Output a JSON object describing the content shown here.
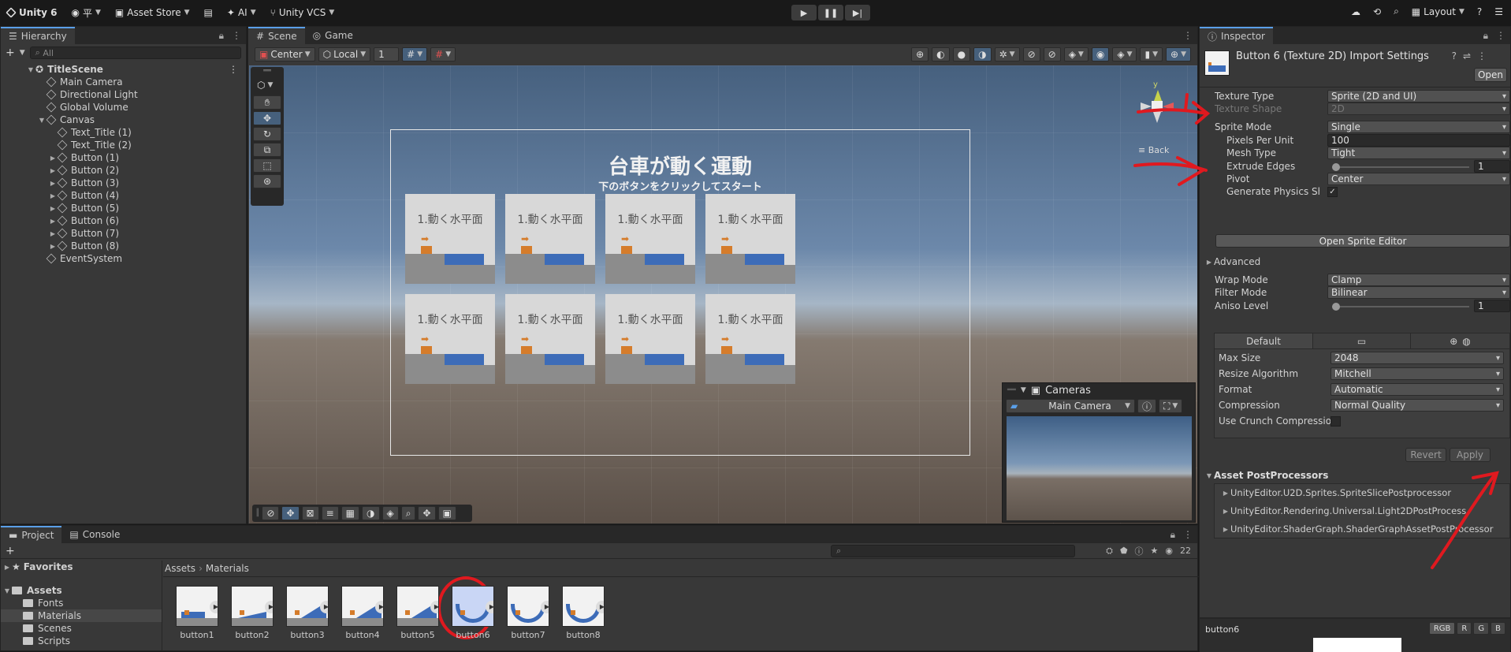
{
  "topbar": {
    "app": "Unity 6",
    "account": "平",
    "asset_store": "Asset Store",
    "ai": "AI",
    "vcs": "Unity VCS",
    "layout": "Layout"
  },
  "hierarchy": {
    "tab": "Hierarchy",
    "search_placeholder": "All",
    "scene": "TitleScene",
    "items": [
      {
        "label": "Main Camera",
        "indent": 1,
        "expandable": false
      },
      {
        "label": "Directional Light",
        "indent": 1,
        "expandable": false
      },
      {
        "label": "Global Volume",
        "indent": 1,
        "expandable": false
      },
      {
        "label": "Canvas",
        "indent": 1,
        "expandable": true,
        "expanded": true
      },
      {
        "label": "Text_Title (1)",
        "indent": 2,
        "expandable": false
      },
      {
        "label": "Text_Title (2)",
        "indent": 2,
        "expandable": false
      },
      {
        "label": "Button (1)",
        "indent": 2,
        "expandable": true
      },
      {
        "label": "Button (2)",
        "indent": 2,
        "expandable": true
      },
      {
        "label": "Button (3)",
        "indent": 2,
        "expandable": true
      },
      {
        "label": "Button (4)",
        "indent": 2,
        "expandable": true
      },
      {
        "label": "Button (5)",
        "indent": 2,
        "expandable": true
      },
      {
        "label": "Button (6)",
        "indent": 2,
        "expandable": true
      },
      {
        "label": "Button (7)",
        "indent": 2,
        "expandable": true
      },
      {
        "label": "Button (8)",
        "indent": 2,
        "expandable": true
      },
      {
        "label": "EventSystem",
        "indent": 1,
        "expandable": false
      }
    ]
  },
  "scene_view": {
    "tabs": [
      "Scene",
      "Game"
    ],
    "pivot": "Center",
    "space": "Local",
    "grid_value": "1",
    "title": "台車が動く運動",
    "subtitle": "下のボタンをクリックしてスタート",
    "card_label": "1.動く水平面",
    "back_label": "Back",
    "gizmo_axis": "y",
    "cameras_title": "Cameras",
    "cameras_selected": "Main Camera"
  },
  "inspector": {
    "tab": "Inspector",
    "title": "Button 6 (Texture 2D) Import Settings",
    "open_button": "Open",
    "fields": {
      "texture_type": {
        "label": "Texture Type",
        "value": "Sprite (2D and UI)"
      },
      "texture_shape": {
        "label": "Texture Shape",
        "value": "2D"
      },
      "sprite_mode": {
        "label": "Sprite Mode",
        "value": "Single"
      },
      "pixels_per_unit": {
        "label": "Pixels Per Unit",
        "value": "100"
      },
      "mesh_type": {
        "label": "Mesh Type",
        "value": "Tight"
      },
      "extrude_edges": {
        "label": "Extrude Edges",
        "value": "1"
      },
      "pivot": {
        "label": "Pivot",
        "value": "Center"
      },
      "generate_physics": {
        "label": "Generate Physics Sha",
        "checked": true
      },
      "wrap_mode": {
        "label": "Wrap Mode",
        "value": "Clamp"
      },
      "filter_mode": {
        "label": "Filter Mode",
        "value": "Bilinear"
      },
      "aniso_level": {
        "label": "Aniso Level",
        "value": "1"
      }
    },
    "open_sprite_editor": "Open Sprite Editor",
    "advanced": "Advanced",
    "platform_tab": "Default",
    "platform_fields": {
      "max_size": {
        "label": "Max Size",
        "value": "2048"
      },
      "resize_algorithm": {
        "label": "Resize Algorithm",
        "value": "Mitchell"
      },
      "format": {
        "label": "Format",
        "value": "Automatic"
      },
      "compression": {
        "label": "Compression",
        "value": "Normal Quality"
      },
      "use_crunch": {
        "label": "Use Crunch Compressio",
        "checked": false
      }
    },
    "revert": "Revert",
    "apply": "Apply",
    "postprocessors_title": "Asset PostProcessors",
    "postprocessors": [
      "UnityEditor.U2D.Sprites.SpriteSlicePostprocessor",
      "UnityEditor.Rendering.Universal.Light2DPostProcess",
      "UnityEditor.ShaderGraph.ShaderGraphAssetPostProcessor"
    ],
    "preview_name": "button6",
    "channels": [
      "RGB",
      "R",
      "G",
      "B"
    ]
  },
  "project": {
    "tabs": [
      "Project",
      "Console"
    ],
    "favorites": "Favorites",
    "assets": "Assets",
    "folders": [
      "Fonts",
      "Materials",
      "Scenes",
      "Scripts"
    ],
    "selected_folder": "Materials",
    "breadcrumb": [
      "Assets",
      "Materials"
    ],
    "hidden_count": "22",
    "asset_items": [
      "button1",
      "button2",
      "button3",
      "button4",
      "button5",
      "button6",
      "button7",
      "button8"
    ],
    "selected_asset": "button6"
  },
  "colors": {
    "accent": "#5a9fe8",
    "annotation": "#e0191f",
    "selection": "#46607c"
  }
}
